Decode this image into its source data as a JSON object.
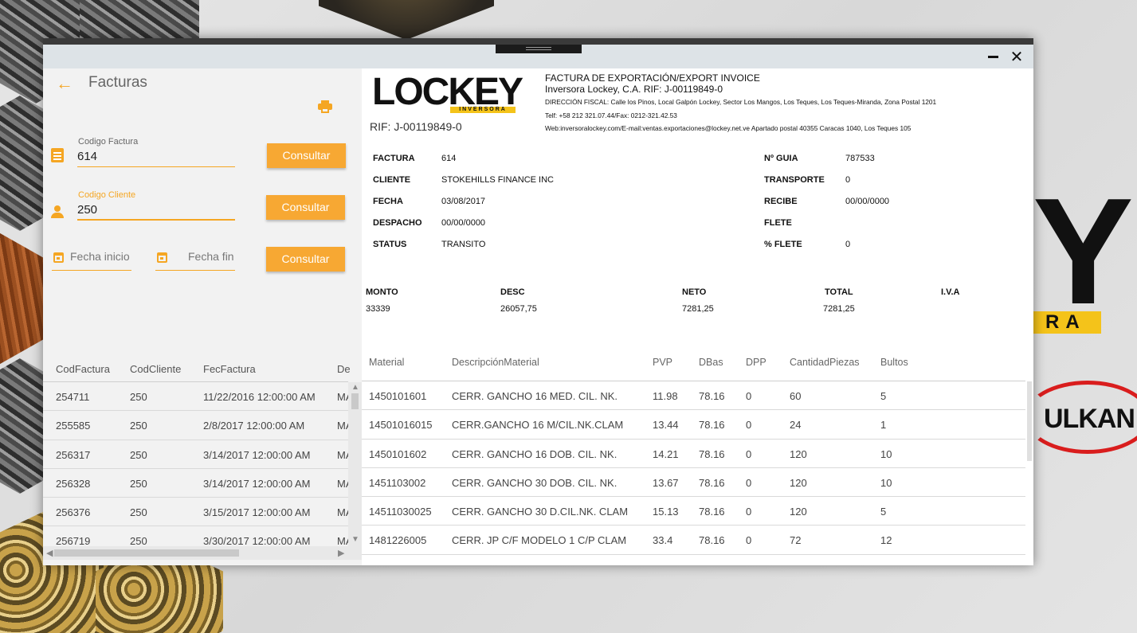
{
  "window": {
    "minimize_glyph": "−",
    "close_glyph": "✕"
  },
  "page": {
    "back_glyph": "←",
    "title": "Facturas"
  },
  "filters": {
    "codigo_factura": {
      "label": "Codigo Factura",
      "value": "614"
    },
    "codigo_cliente": {
      "label": "Codigo Cliente",
      "value": "250"
    },
    "fecha_inicio": {
      "placeholder": "Fecha inicio"
    },
    "fecha_fin": {
      "placeholder": "Fecha fin"
    },
    "consultar_label": "Consultar"
  },
  "invoice_list": {
    "columns": [
      "CodFactura",
      "CodCliente",
      "FecFactura",
      "De"
    ],
    "rows": [
      [
        "254711",
        "250",
        "11/22/2016 12:00:00 AM",
        "MA"
      ],
      [
        "255585",
        "250",
        "2/8/2017 12:00:00 AM",
        "MA"
      ],
      [
        "256317",
        "250",
        "3/14/2017 12:00:00 AM",
        "MA"
      ],
      [
        "256328",
        "250",
        "3/14/2017 12:00:00 AM",
        "MA"
      ],
      [
        "256376",
        "250",
        "3/15/2017 12:00:00 AM",
        "MA"
      ],
      [
        "256719",
        "250",
        "3/30/2017 12:00:00 AM",
        "MA"
      ]
    ]
  },
  "company": {
    "logo_text": "LOCKEY",
    "logo_sub": "INVERSORA",
    "rif": "RIF: J-00119849-0",
    "doc_title": "FACTURA DE EXPORTACIÓN/EXPORT INVOICE",
    "name_line": "Inversora Lockey, C.A. RIF: J-00119849-0",
    "address": "DIRECCIÓN FISCAL: Calle los Pinos, Local Galpón Lockey, Sector Los Mangos, Los Teques, Los Teques-Miranda, Zona Postal 1201",
    "phone": "Telf: +58 212 321.07.44/Fax: 0212-321.42.53",
    "web": "Web:inversoralockey.com/E-mail:ventas.exportaciones@lockey.net.ve Apartado postal 40355 Caracas 1040, Los Teques 105"
  },
  "invoice_details": {
    "left": [
      {
        "key": "FACTURA",
        "value": "614"
      },
      {
        "key": "CLIENTE",
        "value": "STOKEHILLS FINANCE INC"
      },
      {
        "key": "FECHA",
        "value": "03/08/2017"
      },
      {
        "key": "DESPACHO",
        "value": "00/00/0000"
      },
      {
        "key": "STATUS",
        "value": "TRANSITO"
      }
    ],
    "right": [
      {
        "key": "Nº GUIA",
        "value": "787533"
      },
      {
        "key": "TRANSPORTE",
        "value": "0"
      },
      {
        "key": "RECIBE",
        "value": "00/00/0000"
      },
      {
        "key": "FLETE",
        "value": ""
      },
      {
        "key": "% FLETE",
        "value": "0"
      }
    ]
  },
  "totals": [
    {
      "key": "MONTO",
      "value": "33339"
    },
    {
      "key": "DESC",
      "value": "26057,75"
    },
    {
      "key": "NETO",
      "value": "7281,25"
    },
    {
      "key": "TOTAL",
      "value": "7281,25"
    },
    {
      "key": "I.V.A",
      "value": ""
    }
  ],
  "materials": {
    "columns": [
      "Material",
      "DescripciónMaterial",
      "PVP",
      "DBas",
      "DPP",
      "CantidadPiezas",
      "Bultos"
    ],
    "rows": [
      [
        "1450101601",
        "CERR. GANCHO 16 MED. CIL. NK.",
        "11.98",
        "78.16",
        "0",
        "60",
        "5"
      ],
      [
        "14501016015",
        "CERR.GANCHO 16 M/CIL.NK.CLAM",
        "13.44",
        "78.16",
        "0",
        "24",
        "1"
      ],
      [
        "1450101602",
        "CERR. GANCHO 16 DOB. CIL. NK.",
        "14.21",
        "78.16",
        "0",
        "120",
        "10"
      ],
      [
        "1451103002",
        "CERR. GANCHO 30 DOB. CIL. NK.",
        "13.67",
        "78.16",
        "0",
        "120",
        "10"
      ],
      [
        "14511030025",
        "CERR. GANCHO 30 D.CIL.NK. CLAM",
        "15.13",
        "78.16",
        "0",
        "120",
        "5"
      ],
      [
        "1481226005",
        "CERR. JP C/F MODELO 1 C/P CLAM",
        "33.4",
        "78.16",
        "0",
        "72",
        "12"
      ]
    ]
  },
  "background": {
    "brand_letter": "Y",
    "brand_bar": "RA",
    "brand_vulkan": "ULKAN"
  },
  "accent_color": "#f5a623"
}
